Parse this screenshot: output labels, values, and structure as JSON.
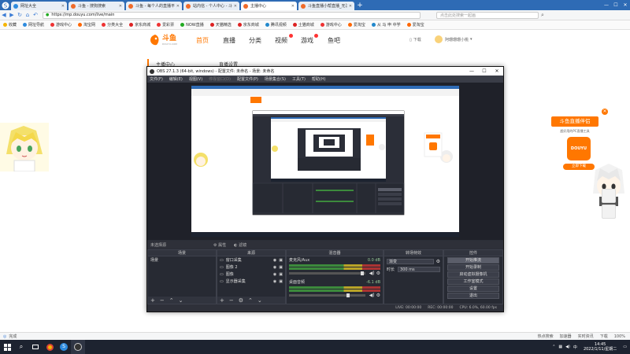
{
  "browser": {
    "tabs": [
      {
        "label": "网址大全",
        "color": "#2e8bde"
      },
      {
        "label": "斗鱼 - 搜狗搜索",
        "color": "#f06b2a"
      },
      {
        "label": "斗鱼 - 每个人的直播平台",
        "color": "#f06b2a"
      },
      {
        "label": "站内信 - 个人中心 - 斗鱼",
        "color": "#f06b2a"
      },
      {
        "label": "主播中心",
        "color": "#f06b2a"
      },
      {
        "label": "斗鱼直播小帮直播_无法",
        "color": "#f06b2a"
      }
    ],
    "url": "https://mp.douyu.com/live/main",
    "search_placeholder": "点击此处搜索一起画",
    "bookmarks": [
      {
        "label": "收藏",
        "color": "#f5b400"
      },
      {
        "label": "网址导航",
        "color": "#2e8bde"
      },
      {
        "label": "游戏中心",
        "color": "#e33"
      },
      {
        "label": "淘宝网",
        "color": "#f60"
      },
      {
        "label": "分类大全",
        "color": "#e33"
      },
      {
        "label": "京东商城",
        "color": "#d22"
      },
      {
        "label": "爱彩票",
        "color": "#e33"
      },
      {
        "label": "NOW直播",
        "color": "#2a2"
      },
      {
        "label": "天猫精选",
        "color": "#d22"
      },
      {
        "label": "京东商城",
        "color": "#d22"
      },
      {
        "label": "腾讯视频",
        "color": "#28c"
      },
      {
        "label": "土猫商城",
        "color": "#d22"
      },
      {
        "label": "游戏中心",
        "color": "#e33"
      },
      {
        "label": "爱淘宝",
        "color": "#f60"
      },
      {
        "label": "从 马 申 中学",
        "color": "#28c"
      },
      {
        "label": "爱淘宝",
        "color": "#f60"
      }
    ],
    "status_left": "完成",
    "status_right": [
      "热点搜索",
      "加速器",
      "实时资讯",
      "下载",
      "100%"
    ]
  },
  "douyu": {
    "logo_text": "斗鱼",
    "logo_sub": "DOUYU.COM",
    "nav": [
      "首页",
      "直播",
      "分类",
      "视频",
      "游戏",
      "鱼吧"
    ],
    "download": "下载",
    "user": "阿珊珊珊小桃",
    "sub_left": "主播中心",
    "sub_right": "直播设置",
    "ad_title": "斗鱼直播伴侣",
    "ad_desc": "超好用的PC直播工具",
    "ad_btn": "立即下载",
    "ad_logo": "DOUYU",
    "accent": "#ff7700"
  },
  "obs": {
    "title": "OBS 27.1.3 (64-bit, windows) - 配置文件: 未命名 - 场景: 未命名",
    "menu": [
      "文件(F)",
      "编辑(E)",
      "视图(V)",
      "停靠窗口(D)",
      "配置文件(P)",
      "场景集合(S)",
      "工具(T)",
      "帮助(H)"
    ],
    "no_source": "未选择源",
    "props_btn": "属性",
    "filter_btn": "滤镜",
    "docks": {
      "scenes": {
        "title": "场景",
        "items": [
          "场景"
        ]
      },
      "sources": {
        "title": "来源",
        "items": [
          "窗口采集",
          "图像 2",
          "图像",
          "显示器采集"
        ]
      },
      "mixer": {
        "title": "混音器",
        "tracks": [
          {
            "name": "麦克风/Aux",
            "db": "0.0 dB"
          },
          {
            "name": "桌面音频",
            "db": "-6.1 dB"
          }
        ]
      },
      "transitions": {
        "title": "转场特效",
        "fade": "渐变",
        "duration_label": "时长",
        "duration": "300 ms"
      },
      "controls": {
        "title": "控件",
        "buttons": [
          "开始推流",
          "开始录制",
          "启动虚拟摄像机",
          "工作室模式",
          "设置",
          "退出"
        ]
      }
    },
    "status": [
      "LIVE: 00:00:00",
      "REC: 00:00:00",
      "CPU: 6.0%, 60.00 fps"
    ]
  },
  "taskbar": {
    "time": "14:45",
    "date": "2022/1/11/星期二"
  }
}
